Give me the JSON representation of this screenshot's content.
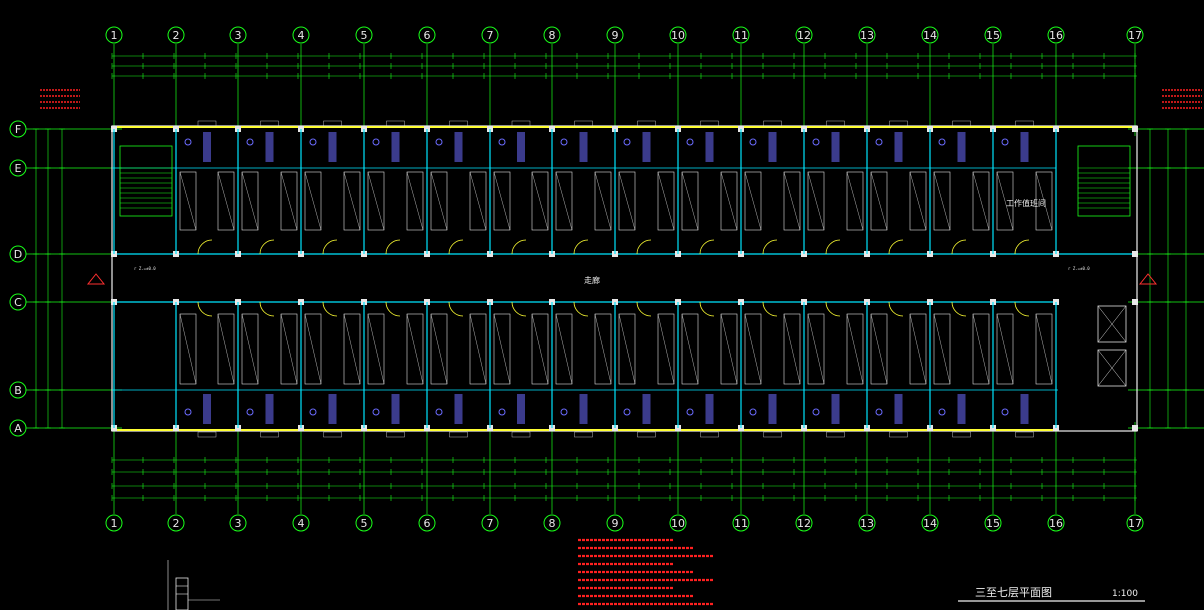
{
  "axes": {
    "columns": [
      "1",
      "2",
      "3",
      "4",
      "5",
      "6",
      "7",
      "8",
      "9",
      "10",
      "11",
      "12",
      "13",
      "14",
      "15",
      "16",
      "17"
    ],
    "rows": [
      "F",
      "E",
      "D",
      "C",
      "B",
      "A"
    ]
  },
  "rooms": {
    "corridor": "走廊",
    "work_room": "工作值班间",
    "stair_tag_top_left": "r Z.=±0.0",
    "stair_tag_top_right": "r Z.=±0.0"
  },
  "title": {
    "main": "三至七层平面图",
    "scale": "1:100"
  },
  "colors": {
    "axis": "#19ff19",
    "wall": "#00e5ff",
    "window": "#ffff33",
    "text": "#ffffff",
    "note": "#ff2020",
    "door": "#ffff33",
    "fixture": "#6b6bff"
  }
}
